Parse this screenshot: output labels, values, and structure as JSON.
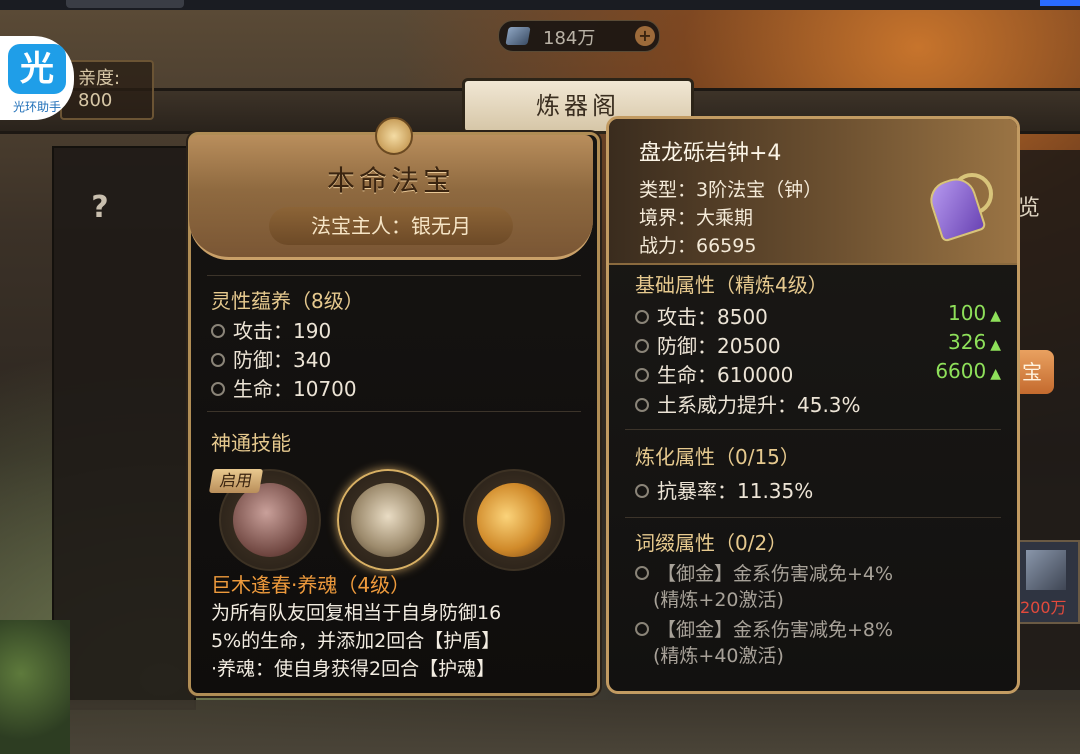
{
  "currency": {
    "amount": "184万",
    "plus": "+"
  },
  "logo": {
    "glyph": "光",
    "caption": "光环助手"
  },
  "left_stat": {
    "line1": "亲度:",
    "line2": "800"
  },
  "hall_sign": "炼器阁",
  "help_icon": "?",
  "side": {
    "text1": "览",
    "button": "宝",
    "tag_amount": "200万"
  },
  "left_panel": {
    "title": "本命法宝",
    "owner": "法宝主人：银无月",
    "nurture": {
      "title": "灵性蕴养（8级）",
      "stats": [
        "攻击：190",
        "防御：340",
        "生命：10700"
      ]
    },
    "skills_title": "神通技能",
    "skill_badge": "启用",
    "skill_icons": [
      "skill-beast-icon",
      "skill-shield-icon",
      "skill-swirl-icon"
    ],
    "skill_name": "巨木逢春·养魂（4级）",
    "skill_desc": [
      "为所有队友回复相当于自身防御16",
      "5%的生命，并添加2回合【护盾】",
      "·养魂：使自身获得2回合【护魂】"
    ]
  },
  "item": {
    "name": "盘龙砾岩钟+4",
    "type": "类型：3阶法宝（钟）",
    "realm": "境界：大乘期",
    "power": "战力：66595",
    "base_title": "基础属性（精炼4级）",
    "base_stats": [
      {
        "label": "攻击：8500",
        "bonus": "100"
      },
      {
        "label": "防御：20500",
        "bonus": "326"
      },
      {
        "label": "生命：610000",
        "bonus": "6600"
      },
      {
        "label": "土系威力提升：45.3%",
        "bonus": ""
      }
    ],
    "refine_title": "炼化属性（0/15）",
    "refine_stats": [
      "抗暴率：11.35%"
    ],
    "affix_title": "词缀属性（0/2）",
    "affixes": [
      {
        "line1": "【御金】金系伤害减免+4%",
        "line2": "(精炼+20激活)"
      },
      {
        "line1": "【御金】金系伤害减免+8%",
        "line2": "(精炼+40激活)"
      }
    ]
  },
  "colors": {
    "gold": "#e6c98e",
    "bonus_green": "#8ee05a",
    "skill_orange": "#ee9a3c"
  }
}
